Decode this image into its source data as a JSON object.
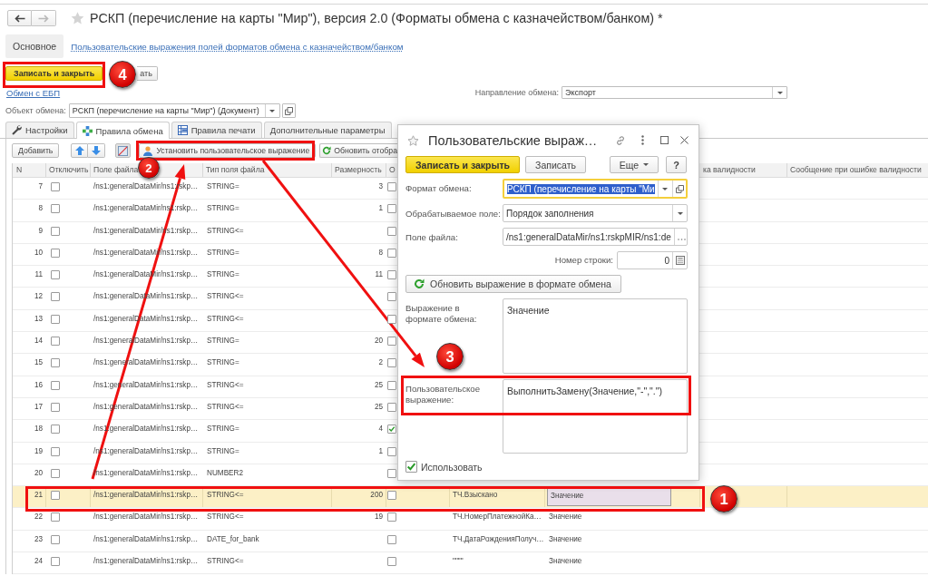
{
  "window": {
    "title": "РСКП (перечисление на карты \"Мир\"), версия 2.0 (Форматы обмена с казначейством/банком) *",
    "back_disabled": false,
    "forward_disabled": true
  },
  "sections": [
    {
      "label": "Основное",
      "selected": true
    },
    {
      "label": "Пользовательские выражения полей форматов обмена с казначейством/банком",
      "selected": false
    }
  ],
  "command_bar": [
    {
      "label": "Записать и закрыть",
      "kind": "primary"
    },
    {
      "label": "ать",
      "kind": "default"
    }
  ],
  "ebp_link": "Обмен с ЕБП",
  "exchange_direction": {
    "label": "Направление обмена:",
    "value": "Экспорт"
  },
  "exchange_object": {
    "label": "Объект обмена:",
    "value": "РСКП (перечисление на карты \"Мир\") (Документ)"
  },
  "tabs": [
    {
      "label": "Настройки",
      "selected": false
    },
    {
      "label": "Правила обмена",
      "selected": true
    },
    {
      "label": "Правила печати",
      "selected": false
    },
    {
      "label": "Дополнительные параметры",
      "selected": false
    }
  ],
  "toolbar": [
    {
      "kind": "text",
      "label": "Добавить"
    },
    {
      "kind": "up"
    },
    {
      "kind": "down"
    },
    {
      "kind": "toggle"
    },
    {
      "kind": "command",
      "label": "Установить пользовательское выражение"
    },
    {
      "kind": "refresh",
      "label": "Обновить отобра"
    }
  ],
  "table": {
    "columns": [
      "N",
      "Отключить",
      "Поле файла",
      "Тип поля файла",
      "Размерность",
      "О",
      "ка валидности",
      "Сообщение при ошибке валидности"
    ],
    "rows": [
      {
        "n": "7",
        "disabled": false,
        "file_field": "/ns1:generalDataMir/ns1:rskp…",
        "field_type": "STRING=",
        "size": "3",
        "column_6": false,
        "selected": false
      },
      {
        "n": "8",
        "disabled": false,
        "file_field": "/ns1:generalDataMir/ns1:rskp…",
        "field_type": "STRING=",
        "size": "1",
        "column_6": false,
        "selected": false
      },
      {
        "n": "9",
        "disabled": false,
        "file_field": "/ns1:generalDataMir/ns1:rskp…",
        "field_type": "STRING<=",
        "column_6": false,
        "selected": false
      },
      {
        "n": "10",
        "disabled": false,
        "file_field": "/ns1:generalDataMir/ns1:rskp…",
        "field_type": "STRING=",
        "size": "8",
        "column_6": false,
        "selected": false
      },
      {
        "n": "11",
        "disabled": false,
        "file_field": "/ns1:generalDataMir/ns1:rskp…",
        "field_type": "STRING=",
        "size": "11",
        "column_6": false,
        "selected": false
      },
      {
        "n": "12",
        "disabled": false,
        "file_field": "/ns1:generalDataMir/ns1:rskp…",
        "field_type": "STRING<=",
        "column_6": false,
        "selected": false
      },
      {
        "n": "13",
        "disabled": false,
        "file_field": "/ns1:generalDataMir/ns1:rskp…",
        "field_type": "STRING<=",
        "column_6": false,
        "selected": false
      },
      {
        "n": "14",
        "disabled": false,
        "file_field": "/ns1:generalDataMir/ns1:rskp…",
        "field_type": "STRING=",
        "size": "20",
        "column_6": false,
        "selected": false
      },
      {
        "n": "15",
        "disabled": false,
        "file_field": "/ns1:generalDataMir/ns1:rskp…",
        "field_type": "STRING=",
        "size": "2",
        "column_6": false,
        "selected": false
      },
      {
        "n": "16",
        "disabled": false,
        "file_field": "/ns1:generalDataMir/ns1:rskp…",
        "field_type": "STRING<=",
        "size": "25",
        "column_6": false,
        "selected": false
      },
      {
        "n": "17",
        "disabled": false,
        "file_field": "/ns1:generalDataMir/ns1:rskp…",
        "field_type": "STRING<=",
        "size": "25",
        "column_6": false,
        "selected": false
      },
      {
        "n": "18",
        "disabled": false,
        "file_field": "/ns1:generalDataMir/ns1:rskp…",
        "field_type": "STRING=",
        "size": "4",
        "column_6": true,
        "selected": false
      },
      {
        "n": "19",
        "disabled": false,
        "file_field": "/ns1:generalDataMir/ns1:rskp…",
        "field_type": "STRING=",
        "size": "1",
        "column_6": false,
        "selected": false
      },
      {
        "n": "20",
        "disabled": false,
        "file_field": "/ns1:generalDataMir/ns1:rskp…",
        "field_type": "NUMBER2",
        "column_6": false,
        "selected": false
      },
      {
        "n": "21",
        "disabled": false,
        "file_field": "/ns1:generalDataMir/ns1:rskp…",
        "field_type": "STRING<=",
        "size": "200",
        "column_6": false,
        "column_7": "ТЧ.Взыскано",
        "column_8": "Значение",
        "selected": true
      },
      {
        "n": "22",
        "disabled": false,
        "file_field": "/ns1:generalDataMir/ns1:rskp…",
        "field_type": "STRING<=",
        "size": "19",
        "column_6": false,
        "column_7": "ТЧ.НомерПлатежнойКа…",
        "column_8": "Значение",
        "selected": false
      },
      {
        "n": "23",
        "disabled": false,
        "file_field": "/ns1:generalDataMir/ns1:rskp…",
        "field_type": "DATE_for_bank",
        "column_6": false,
        "column_7": "ТЧ.ДатаРожденияПолуч…",
        "column_8": "Значение",
        "selected": false
      },
      {
        "n": "24",
        "disabled": false,
        "file_field": "/ns1:generalDataMir/ns1:rskp…",
        "field_type": "STRING<=",
        "column_6": false,
        "column_7": "\"\"\"\"",
        "column_8": "Значение",
        "selected": false
      }
    ]
  },
  "dialog": {
    "title": "Пользовательские выраж…",
    "buttons": [
      {
        "label": "Записать и закрыть",
        "kind": "primary"
      },
      {
        "label": "Записать",
        "kind": "default"
      },
      {
        "label": "Еще",
        "kind": "menu"
      },
      {
        "label": "?",
        "kind": "help"
      }
    ],
    "fields": [
      {
        "kind": "select",
        "label": "Формат обмена:",
        "value": "РСКП (перечисление на карты \"Ми",
        "focused": true,
        "open_button": true
      },
      {
        "kind": "select",
        "label": "Обрабатываемое поле:",
        "value": "Порядок заполнения",
        "focused": false
      },
      {
        "kind": "choice",
        "label": "Поле файла:",
        "value": "/ns1:generalDataMir/ns1:rskpMIR/ns1:de",
        "focused": false
      },
      {
        "kind": "number",
        "label": "Номер строки:",
        "value": "0",
        "focused": false
      },
      {
        "kind": "button",
        "label": "Обновить выражение в формате обмена"
      },
      {
        "kind": "textarea",
        "label": "Выражение в формате обмена:",
        "value": "Значение",
        "focused": false
      },
      {
        "kind": "textarea",
        "label": "Пользовательское выражение:",
        "value": "ВыполнитьЗамену(Значение,\"-\",\".\")",
        "focused": false
      },
      {
        "kind": "checkbox",
        "label": "Использовать",
        "checked": true
      }
    ]
  },
  "callouts": [
    {
      "label": "4"
    },
    {
      "label": "2"
    },
    {
      "label": "3"
    },
    {
      "label": "1"
    }
  ]
}
